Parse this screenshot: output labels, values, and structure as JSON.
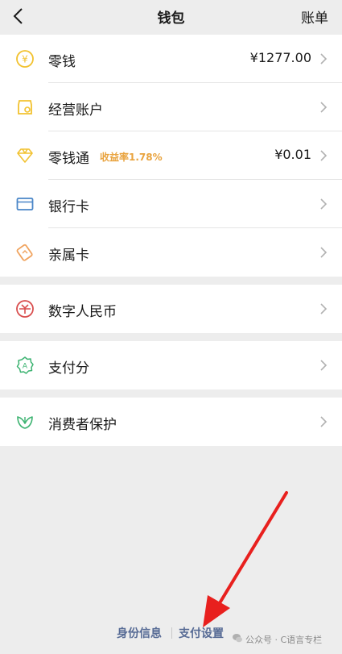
{
  "header": {
    "title": "钱包",
    "right_action": "账单"
  },
  "groups": [
    {
      "items": [
        {
          "label": "零钱",
          "value": "¥1277.00"
        },
        {
          "label": "经营账户",
          "value": ""
        },
        {
          "label": "零钱通",
          "badge": "收益率1.78%",
          "value": "¥0.01"
        },
        {
          "label": "银行卡",
          "value": ""
        },
        {
          "label": "亲属卡",
          "value": ""
        }
      ]
    },
    {
      "items": [
        {
          "label": "数字人民币"
        }
      ]
    },
    {
      "items": [
        {
          "label": "支付分"
        }
      ]
    },
    {
      "items": [
        {
          "label": "消费者保护"
        }
      ]
    }
  ],
  "footer": {
    "identity": "身份信息",
    "pay_settings": "支付设置"
  },
  "watermark": {
    "text": "公众号 · C语言专栏"
  },
  "colors": {
    "accent_yellow": "#f2c230",
    "link_blue": "#576b95",
    "arrow_red": "#e8201e",
    "green": "#3cb371",
    "red": "#d94f4f",
    "blue": "#4a86c8",
    "orange": "#f0a35e"
  }
}
